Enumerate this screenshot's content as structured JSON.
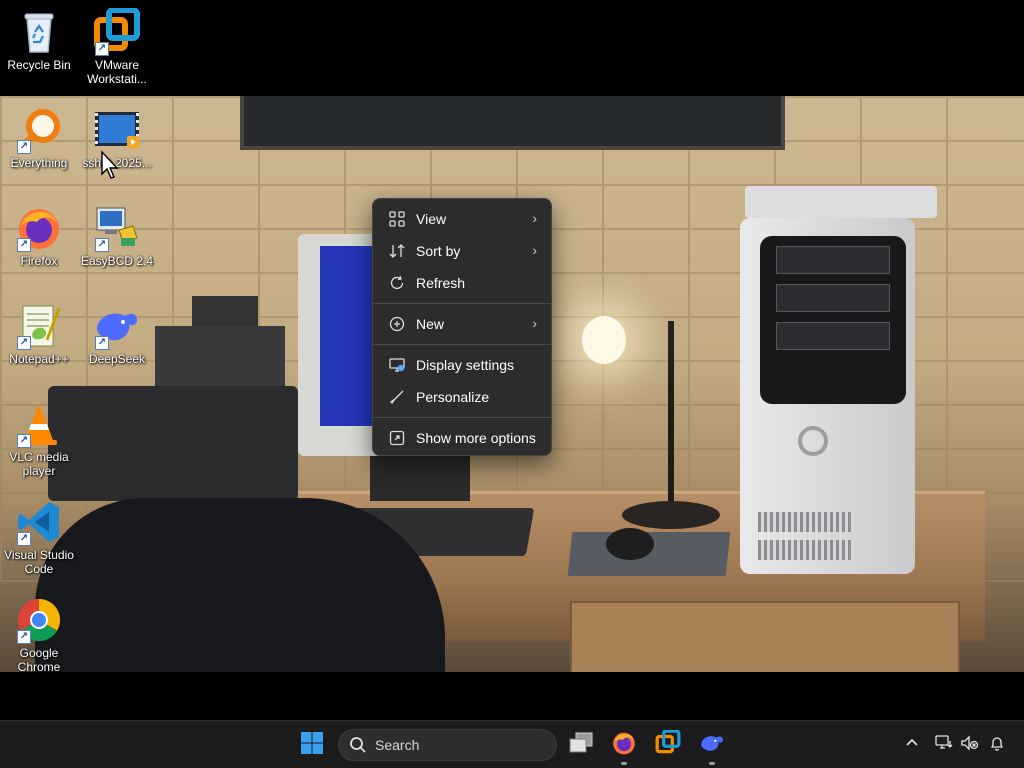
{
  "desktop": {
    "icons": [
      {
        "label": "Recycle Bin",
        "icon": "recycle-bin-icon",
        "shortcut": false
      },
      {
        "label": "VMware Workstati...",
        "icon": "vmware-icon",
        "shortcut": true
      },
      {
        "label": "Everything",
        "icon": "everything-search-icon",
        "shortcut": true
      },
      {
        "label": "sshot-2025...",
        "icon": "video-file-icon",
        "shortcut": false
      },
      {
        "label": "Firefox",
        "icon": "firefox-icon",
        "shortcut": true
      },
      {
        "label": "EasyBCD 2.4",
        "icon": "easybcd-icon",
        "shortcut": true
      },
      {
        "label": "Notepad++",
        "icon": "notepadpp-icon",
        "shortcut": true
      },
      {
        "label": "DeepSeek",
        "icon": "deepseek-icon",
        "shortcut": true
      },
      {
        "label": "VLC media player",
        "icon": "vlc-icon",
        "shortcut": true
      },
      {
        "label": "Visual Studio Code",
        "icon": "vscode-icon",
        "shortcut": true
      },
      {
        "label": "Google Chrome",
        "icon": "chrome-icon",
        "shortcut": true
      }
    ]
  },
  "context_menu": {
    "items": [
      {
        "label": "View",
        "icon": "view-grid-icon",
        "submenu": true
      },
      {
        "label": "Sort by",
        "icon": "sort-icon",
        "submenu": true
      },
      {
        "label": "Refresh",
        "icon": "refresh-icon",
        "submenu": false
      },
      {
        "label": "New",
        "icon": "new-plus-icon",
        "submenu": true
      },
      {
        "label": "Display settings",
        "icon": "display-settings-icon",
        "submenu": false
      },
      {
        "label": "Personalize",
        "icon": "personalize-brush-icon",
        "submenu": false
      },
      {
        "label": "Show more options",
        "icon": "show-more-options-icon",
        "submenu": false
      }
    ]
  },
  "taskbar": {
    "start": {
      "icon": "windows-start-icon"
    },
    "search": {
      "placeholder": "Search",
      "icon": "search-icon"
    },
    "apps": [
      {
        "name": "task-view",
        "icon": "task-view-icon",
        "running": false
      },
      {
        "name": "firefox",
        "icon": "firefox-icon",
        "running": true
      },
      {
        "name": "vmware",
        "icon": "vmware-icon",
        "running": false
      },
      {
        "name": "deepseek",
        "icon": "deepseek-icon",
        "running": true
      }
    ],
    "tray": [
      {
        "name": "show-hidden-icons",
        "icon": "chevron-up-icon"
      },
      {
        "name": "network",
        "icon": "network-icon"
      },
      {
        "name": "volume-muted",
        "icon": "volume-muted-icon"
      },
      {
        "name": "notifications",
        "icon": "bell-icon"
      }
    ]
  },
  "colors": {
    "menu_bg": "#2c2c2c",
    "taskbar_bg": "#1c1c1c",
    "accent": "#0078d4"
  }
}
